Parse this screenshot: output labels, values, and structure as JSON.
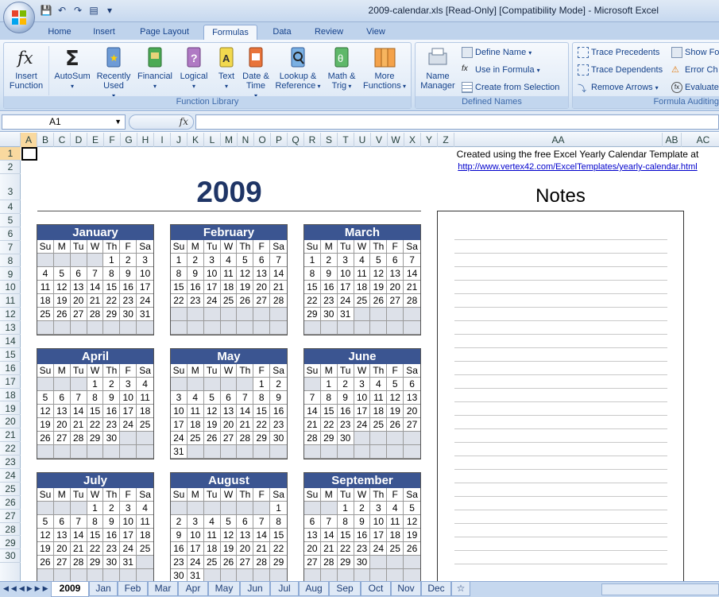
{
  "window": {
    "title": "2009-calendar.xls  [Read-Only]  [Compatibility Mode] - Microsoft Excel"
  },
  "tabs": [
    "Home",
    "Insert",
    "Page Layout",
    "Formulas",
    "Data",
    "Review",
    "View"
  ],
  "active_tab": "Formulas",
  "ribbon": {
    "function_library": {
      "label": "Function Library",
      "insert_function": "Insert Function",
      "autosum": "AutoSum",
      "recently_used": "Recently Used",
      "financial": "Financial",
      "logical": "Logical",
      "text": "Text",
      "date_time": "Date & Time",
      "lookup": "Lookup & Reference",
      "math": "Math & Trig",
      "more": "More Functions"
    },
    "defined_names": {
      "label": "Defined Names",
      "name_manager": "Name Manager",
      "define_name": "Define Name",
      "use_in_formula": "Use in Formula",
      "create_from_selection": "Create from Selection"
    },
    "formula_auditing": {
      "label": "Formula Auditing",
      "trace_precedents": "Trace Precedents",
      "trace_dependents": "Trace Dependents",
      "remove_arrows": "Remove Arrows",
      "show_formulas": "Show Fo",
      "error_checking": "Error Ch",
      "evaluate": "Evaluate"
    }
  },
  "formula_bar": {
    "name_box": "A1",
    "fx": "fx",
    "value": ""
  },
  "columns": [
    "A",
    "B",
    "C",
    "D",
    "E",
    "F",
    "G",
    "H",
    "I",
    "J",
    "K",
    "L",
    "M",
    "N",
    "O",
    "P",
    "Q",
    "R",
    "S",
    "T",
    "U",
    "V",
    "W",
    "X",
    "Y",
    "Z",
    "AA",
    "AB",
    "AC"
  ],
  "rows": [
    "1",
    "2",
    "3",
    "4",
    "5",
    "6",
    "7",
    "8",
    "9",
    "10",
    "11",
    "12",
    "13",
    "14",
    "15",
    "16",
    "17",
    "18",
    "19",
    "20",
    "21",
    "22",
    "23",
    "24",
    "25",
    "26",
    "27",
    "28",
    "29",
    "30"
  ],
  "sheet": {
    "credit_text": "Created using the free Excel Yearly Calendar Template at",
    "credit_link": "http://www.vertex42.com/ExcelTemplates/yearly-calendar.html",
    "year": "2009",
    "notes_title": "Notes"
  },
  "weekdays": [
    "Su",
    "M",
    "Tu",
    "W",
    "Th",
    "F",
    "Sa"
  ],
  "months": [
    {
      "name": "January",
      "start": 4,
      "days": 31
    },
    {
      "name": "February",
      "start": 0,
      "days": 28
    },
    {
      "name": "March",
      "start": 0,
      "days": 31
    },
    {
      "name": "April",
      "start": 3,
      "days": 30
    },
    {
      "name": "May",
      "start": 5,
      "days": 31
    },
    {
      "name": "June",
      "start": 1,
      "days": 30
    },
    {
      "name": "July",
      "start": 3,
      "days": 31
    },
    {
      "name": "August",
      "start": 6,
      "days": 31
    },
    {
      "name": "September",
      "start": 2,
      "days": 30
    }
  ],
  "sheet_tabs": [
    "2009",
    "Jan",
    "Feb",
    "Mar",
    "Apr",
    "May",
    "Jun",
    "Jul",
    "Aug",
    "Sep",
    "Oct",
    "Nov",
    "Dec"
  ],
  "active_sheet": "2009"
}
